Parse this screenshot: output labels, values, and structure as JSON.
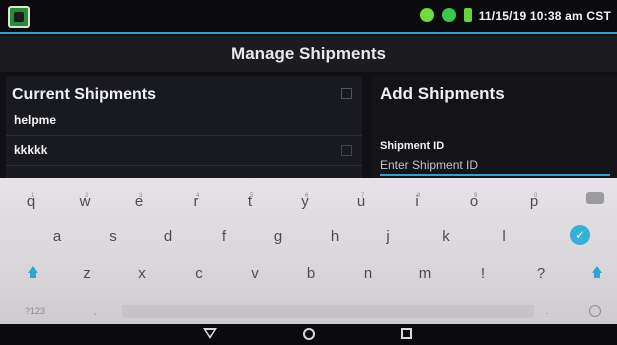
{
  "status_bar": {
    "datetime": "11/15/19 10:38 am CST",
    "icons": [
      "app-icon",
      "location-icon",
      "signal-icon",
      "battery-charging-icon"
    ]
  },
  "header": {
    "title": "Manage Shipments"
  },
  "current_shipments": {
    "heading": "Current Shipments",
    "items": [
      "helpme",
      "kkkkk"
    ]
  },
  "add_shipments": {
    "heading": "Add Shipments",
    "field_label": "Shipment ID",
    "field_placeholder": "Enter Shipment ID",
    "field_value": ""
  },
  "keyboard": {
    "row1": [
      "q",
      "w",
      "e",
      "r",
      "t",
      "y",
      "u",
      "i",
      "o",
      "p"
    ],
    "row1_hints": [
      "1",
      "2",
      "3",
      "4",
      "5",
      "6",
      "7",
      "8",
      "9",
      "0"
    ],
    "row2": [
      "a",
      "s",
      "d",
      "f",
      "g",
      "h",
      "j",
      "k",
      "l"
    ],
    "row3": [
      "z",
      "x",
      "c",
      "v",
      "b",
      "n",
      "m",
      "!",
      "?"
    ],
    "symbols_key": "?123",
    "comma_key": ",",
    "period_key": ".",
    "accent_color": "#35b1d8"
  },
  "nav_bar": {
    "icons": [
      "back-icon",
      "home-icon",
      "recent-apps-icon"
    ]
  }
}
